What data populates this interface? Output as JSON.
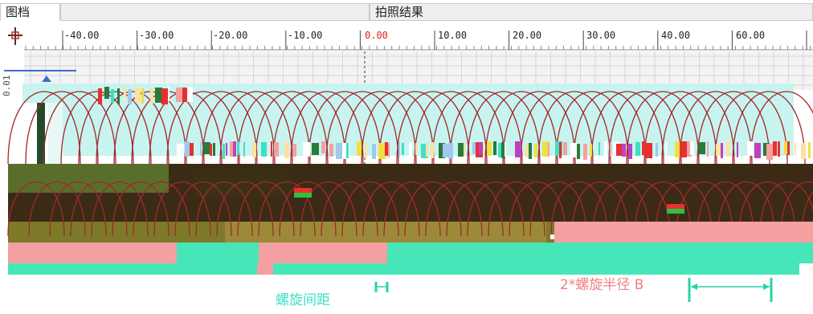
{
  "tabs": [
    {
      "label": "图档"
    },
    {
      "label": "拍照结果"
    }
  ],
  "ruler": {
    "ticks": [
      "-40.00",
      "-30.00",
      "-20.00",
      "-10.00",
      "0.00",
      "10.00",
      "20.00",
      "30.00",
      "40.00",
      "60.00"
    ],
    "zero_color": "#e02020"
  },
  "vertical_ruler": {
    "label": "0.01"
  },
  "annotations": {
    "pitch": "螺旋间距",
    "diameter": "2*螺旋半径 B"
  },
  "colors": {
    "spiral": "#a02a2a",
    "dark_band": "#3b2a16",
    "olive": "#7d7a2a",
    "cyan_band": "#c8f4f0",
    "mint": "#46e6b8",
    "pink": "#f4a0a0",
    "guide": "#2ad2a8",
    "red_arrow": "#e83030"
  }
}
